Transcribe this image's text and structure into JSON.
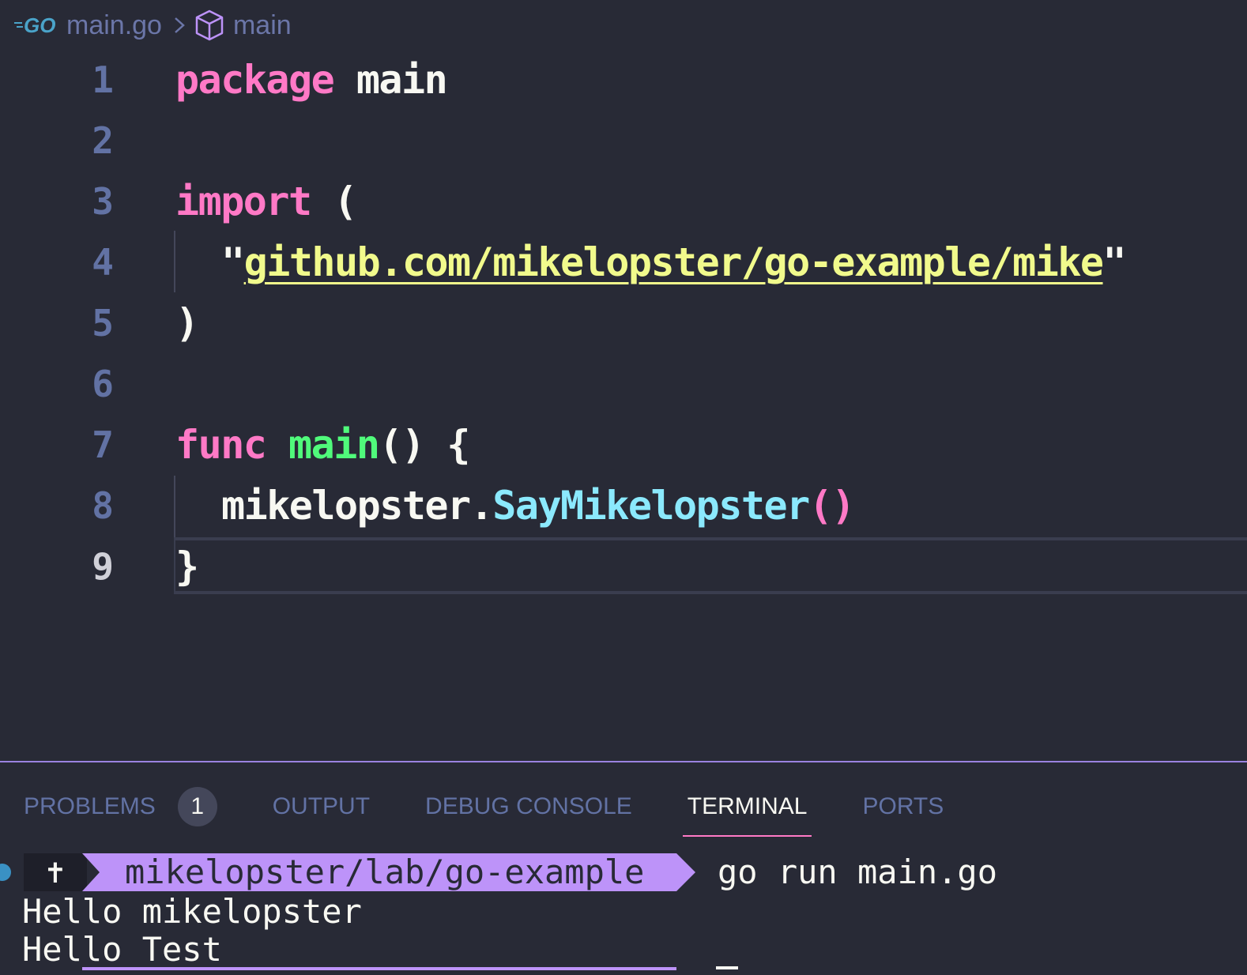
{
  "breadcrumb": {
    "file": "main.go",
    "symbol": "main"
  },
  "editor": {
    "lines": [
      {
        "number": "1",
        "tokens": [
          "package",
          " main"
        ]
      },
      {
        "number": "2"
      },
      {
        "number": "3",
        "tokens": [
          "import",
          " ("
        ]
      },
      {
        "number": "4",
        "tokens": [
          "\"",
          "github.com/mikelopster/go-example/mike",
          "\""
        ]
      },
      {
        "number": "5",
        "tokens": [
          ")"
        ]
      },
      {
        "number": "6"
      },
      {
        "number": "7",
        "tokens": [
          "func",
          " ",
          "main",
          "() {"
        ]
      },
      {
        "number": "8",
        "tokens": [
          "mikelopster.",
          "SayMikelopster",
          "()"
        ]
      },
      {
        "number": "9",
        "tokens": [
          "}"
        ]
      }
    ]
  },
  "panel": {
    "tabs": [
      {
        "label": "PROBLEMS",
        "badge": "1"
      },
      {
        "label": "OUTPUT"
      },
      {
        "label": "DEBUG CONSOLE"
      },
      {
        "label": "TERMINAL",
        "active": true
      },
      {
        "label": "PORTS"
      }
    ]
  },
  "terminal": {
    "prompt_symbol": "✝",
    "prompt_path": "mikelopster/lab/go-example",
    "command": "go run main.go",
    "output": [
      "Hello mikelopster",
      "Hello Test"
    ]
  },
  "colors": {
    "background": "#282a36",
    "keyword": "#ff79c6",
    "function": "#50fa7b",
    "string": "#f1fa8c",
    "method": "#8be9fd",
    "line_number": "#6272a4",
    "prompt_accent": "#bd93f9"
  }
}
